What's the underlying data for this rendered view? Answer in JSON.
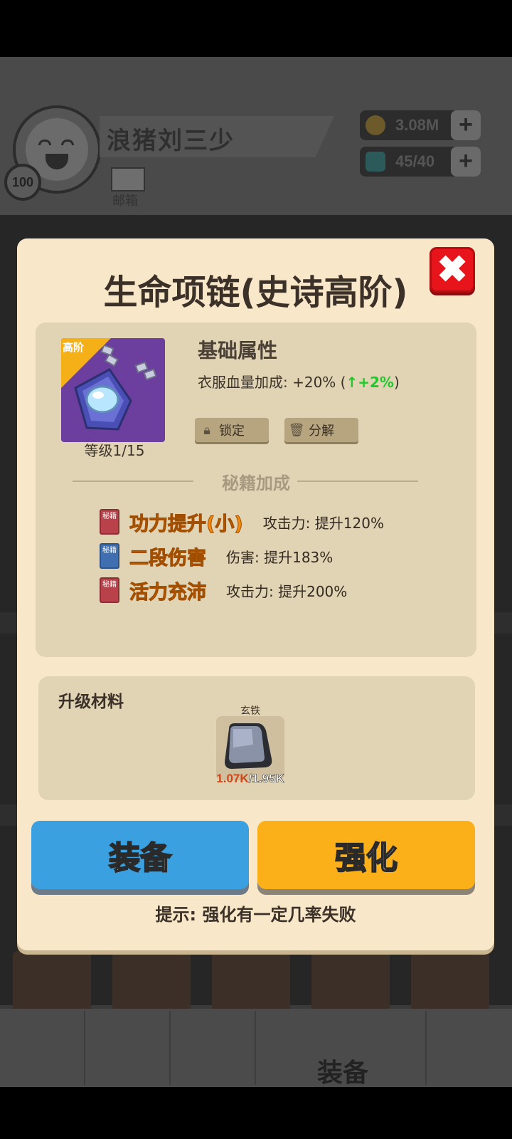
{
  "player": {
    "name": "浪猪刘三少",
    "level": "100",
    "mail_label": "邮箱"
  },
  "resources": {
    "gold": "3.08M",
    "gems": "45/40",
    "plus": "+"
  },
  "modal": {
    "title": "生命项链(史诗高阶)",
    "close_icon": "close-icon",
    "item": {
      "tier_tag": "高阶",
      "level": "等级1/15",
      "icon": "necklace-icon"
    },
    "attributes": {
      "heading": "基础属性",
      "line_prefix": "衣服血量加成: +20% (",
      "line_arrow": "↑",
      "line_bonus": "+2%",
      "line_suffix": ")"
    },
    "buttons": {
      "lock": "锁定",
      "dismantle": "分解"
    },
    "secret_title": "秘籍加成",
    "skills": [
      {
        "book": "秘籍",
        "name": "功力提升(小)",
        "effect": "攻击力: 提升120%",
        "color": "#b8414a"
      },
      {
        "book": "秘籍",
        "name": "二段伤害",
        "effect": "伤害: 提升183%",
        "color": "#3f6fb0"
      },
      {
        "book": "秘籍",
        "name": "活力充沛",
        "effect": "攻击力: 提升200%",
        "color": "#b8414a"
      }
    ],
    "materials": {
      "heading": "升级材料",
      "item_name": "玄铁",
      "have": "1.07K",
      "need": "/1.95K"
    },
    "equip_label": "装备",
    "strengthen_label": "强化",
    "hint": "提示: 强化有一定几率失败"
  },
  "nav": {
    "equip_label": "装备"
  },
  "colors": {
    "equip_btn": "#3aa0e0",
    "strengthen_btn": "#fbb01a",
    "close_btn": "#e8141b",
    "bonus_green": "#1ec92b"
  }
}
